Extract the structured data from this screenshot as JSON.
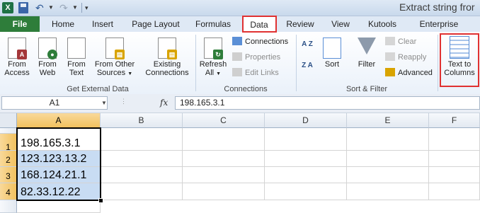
{
  "window": {
    "app_icon_letter": "X",
    "title": "Extract string fror"
  },
  "tabs": [
    {
      "label": "File"
    },
    {
      "label": "Home"
    },
    {
      "label": "Insert"
    },
    {
      "label": "Page Layout"
    },
    {
      "label": "Formulas"
    },
    {
      "label": "Data"
    },
    {
      "label": "Review"
    },
    {
      "label": "View"
    },
    {
      "label": "Kutools"
    },
    {
      "label": "Enterprise"
    }
  ],
  "active_tab": "Data",
  "ribbon": {
    "get_external_data": {
      "label": "Get External Data",
      "from_access": [
        "From",
        "Access"
      ],
      "from_web": [
        "From",
        "Web"
      ],
      "from_text": [
        "From",
        "Text"
      ],
      "from_other_sources": [
        "From Other",
        "Sources"
      ],
      "existing_connections": [
        "Existing",
        "Connections"
      ]
    },
    "connections": {
      "label": "Connections",
      "refresh_all": [
        "Refresh",
        "All"
      ],
      "connections": "Connections",
      "properties": "Properties",
      "edit_links": "Edit Links"
    },
    "sort_filter": {
      "label": "Sort & Filter",
      "sort_az": "A Z",
      "sort_za": "Z A",
      "sort": "Sort",
      "filter": "Filter",
      "clear": "Clear",
      "reapply": "Reapply",
      "advanced": "Advanced"
    },
    "data_tools": {
      "text_to_columns": [
        "Text to",
        "Columns"
      ]
    }
  },
  "formula_bar": {
    "name_box": "A1",
    "fx_label": "fx",
    "value": "198.165.3.1"
  },
  "sheet": {
    "columns": [
      "A",
      "B",
      "C",
      "D",
      "E",
      "F"
    ],
    "rows": [
      "1",
      "2",
      "3",
      "4"
    ],
    "cells": [
      "198.165.3.1",
      "123.123.13.2",
      "168.124.21.1",
      "82.33.12.22"
    ]
  },
  "colors": {
    "file_tab": "#2e7d3a",
    "highlight_red": "#e03131",
    "selection_fill": "#c8dcf3",
    "header_selected": "#f1c15f"
  }
}
